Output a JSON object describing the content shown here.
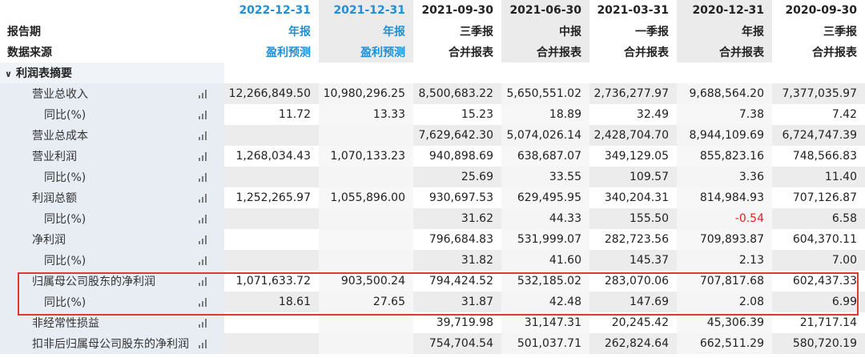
{
  "header": {
    "dates": [
      "2022-12-31",
      "2021-12-31",
      "2021-09-30",
      "2021-06-30",
      "2021-03-31",
      "2020-12-31",
      "2020-09-30"
    ],
    "period_label": "报告期",
    "periods": [
      "年报",
      "年报",
      "三季报",
      "中报",
      "一季报",
      "年报",
      "三季报"
    ],
    "source_label": "数据来源",
    "sources": [
      "盈利预测",
      "盈利预测",
      "合并报表",
      "合并报表",
      "合并报表",
      "合并报表",
      "合并报表"
    ]
  },
  "section": {
    "title": "利润表摘要",
    "caret": "∨"
  },
  "icons": {
    "row_chart": "bar-chart-icon"
  },
  "colors": {
    "forecast_blue": "#1f8fd8",
    "negative_red": "#e02020",
    "highlight_red": "#e03a2f"
  },
  "rows": [
    {
      "label": "营业总收入",
      "values": [
        "12,266,849.50",
        "10,980,296.25",
        "8,500,683.22",
        "5,650,551.02",
        "2,736,277.97",
        "9,688,564.20",
        "7,377,035.97"
      ]
    },
    {
      "label": "同比(%)",
      "values": [
        "11.72",
        "13.33",
        "15.23",
        "18.89",
        "32.49",
        "7.38",
        "7.42"
      ]
    },
    {
      "label": "营业总成本",
      "values": [
        "",
        "",
        "7,629,642.30",
        "5,074,026.14",
        "2,428,704.70",
        "8,944,109.69",
        "6,724,747.39"
      ]
    },
    {
      "label": "营业利润",
      "values": [
        "1,268,034.43",
        "1,070,133.23",
        "940,898.69",
        "638,687.07",
        "349,129.05",
        "855,823.16",
        "748,566.83"
      ]
    },
    {
      "label": "同比(%)",
      "values": [
        "",
        "",
        "25.69",
        "33.55",
        "109.57",
        "3.36",
        "11.40"
      ]
    },
    {
      "label": "利润总额",
      "values": [
        "1,252,265.97",
        "1,055,896.00",
        "930,697.53",
        "629,495.95",
        "340,204.31",
        "814,984.93",
        "707,126.87"
      ]
    },
    {
      "label": "同比(%)",
      "values": [
        "",
        "",
        "31.62",
        "44.33",
        "155.50",
        "-0.54",
        "6.58"
      ]
    },
    {
      "label": "净利润",
      "values": [
        "",
        "",
        "796,684.83",
        "531,999.07",
        "282,723.56",
        "709,893.87",
        "604,370.11"
      ]
    },
    {
      "label": "同比(%)",
      "values": [
        "",
        "",
        "31.82",
        "41.60",
        "145.37",
        "2.13",
        "7.00"
      ]
    },
    {
      "label": "归属母公司股东的净利润",
      "values": [
        "1,071,633.72",
        "903,500.24",
        "794,424.52",
        "532,185.02",
        "283,070.06",
        "707,817.68",
        "602,437.33"
      ]
    },
    {
      "label": "同比(%)",
      "values": [
        "18.61",
        "27.65",
        "31.87",
        "42.48",
        "147.69",
        "2.08",
        "6.99"
      ]
    },
    {
      "label": "非经常性损益",
      "values": [
        "",
        "",
        "39,719.98",
        "31,147.31",
        "20,245.42",
        "45,306.39",
        "21,717.14"
      ]
    },
    {
      "label": "扣非后归属母公司股东的净利润",
      "values": [
        "",
        "",
        "754,704.54",
        "501,037.71",
        "262,824.64",
        "662,511.29",
        "580,720.19"
      ]
    }
  ]
}
